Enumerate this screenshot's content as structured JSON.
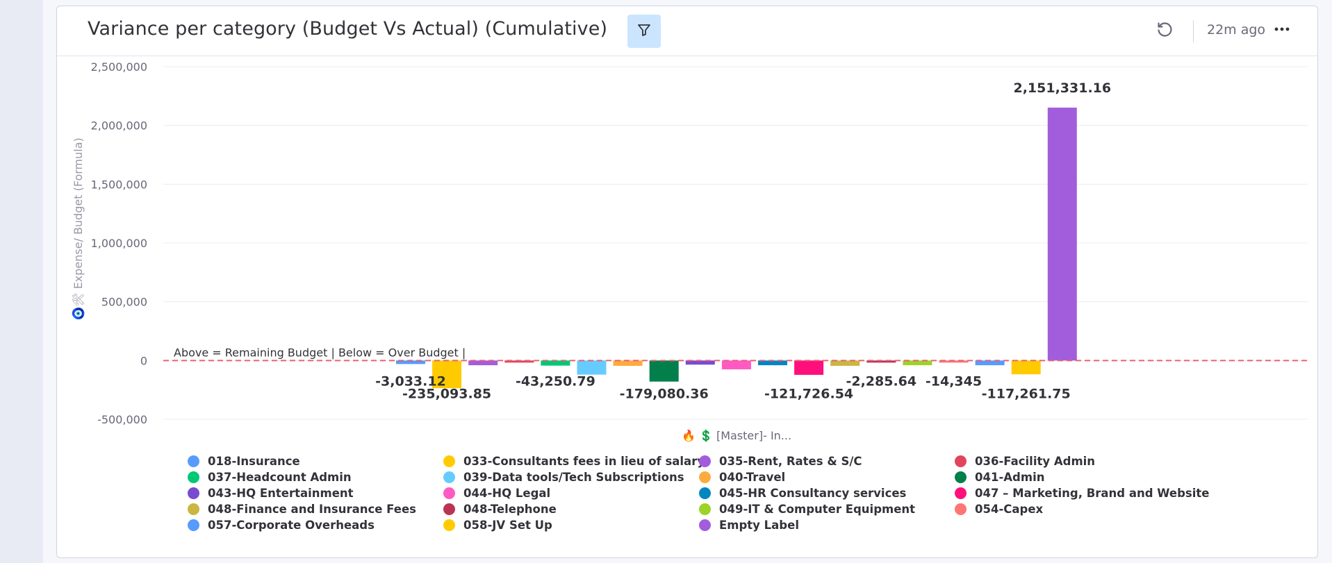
{
  "header": {
    "title": "Variance per category (Budget Vs Actual) (Cumulative)",
    "updated": "22m ago"
  },
  "icons": {
    "filter": "filter-funnel-icon",
    "refresh": "refresh-icon",
    "more": "more-horizontal-icon"
  },
  "chart_data": {
    "type": "bar",
    "title": "Variance per category (Budget Vs Actual) (Cumulative)",
    "ylabel": "🧿🛠 Expense/ Budget (Formula)",
    "xlabel": "🔥 💲 [Master]- In...",
    "ylim": [
      -500000,
      2500000
    ],
    "y_ticks": [
      {
        "value": 2500000,
        "label": "2,500,000"
      },
      {
        "value": 2000000,
        "label": "2,000,000"
      },
      {
        "value": 1500000,
        "label": "1,500,000"
      },
      {
        "value": 1000000,
        "label": "1,000,000"
      },
      {
        "value": 500000,
        "label": "500,000"
      },
      {
        "value": 0,
        "label": "0"
      },
      {
        "value": -500000,
        "label": "-500,000"
      }
    ],
    "grid": true,
    "reference_line": {
      "value": 0,
      "label": "Above = Remaining Budget | Below = Over Budget |",
      "color": "#e8616f"
    },
    "legend_position": "bottom",
    "series": [
      {
        "name": "018-Insurance",
        "color": "#579bfc",
        "value": -30000,
        "label": ""
      },
      {
        "name": "033-Consultants fees in lieu of salary",
        "color": "#ffcb00",
        "value": -235093.85,
        "label": "-235,093.85"
      },
      {
        "name": "035-Rent, Rates & S/C",
        "color": "#a25ddc",
        "value": -40000,
        "label": ""
      },
      {
        "name": "036-Facility Admin",
        "color": "#e2445c",
        "value": -3033.12,
        "label": "-3,033.12"
      },
      {
        "name": "037-Headcount Admin",
        "color": "#00c875",
        "value": -43250.79,
        "label": "-43,250.79"
      },
      {
        "name": "039-Data tools/Tech Subscriptions",
        "color": "#66ccff",
        "value": -120000,
        "label": ""
      },
      {
        "name": "040-Travel",
        "color": "#fdab3d",
        "value": -45000,
        "label": ""
      },
      {
        "name": "041-Admin",
        "color": "#037f4c",
        "value": -179080.36,
        "label": "-179,080.36"
      },
      {
        "name": "043-HQ Entertainment",
        "color": "#784bd1",
        "value": -35000,
        "label": ""
      },
      {
        "name": "044-HQ Legal",
        "color": "#ff5ac4",
        "value": -75000,
        "label": ""
      },
      {
        "name": "045-HR Consultancy services",
        "color": "#0086c0",
        "value": -40000,
        "label": ""
      },
      {
        "name": "047 – Marketing, Brand and Website",
        "color": "#ff0f7b",
        "value": -121726.54,
        "label": "-121,726.54"
      },
      {
        "name": "048-Finance and Insurance Fees",
        "color": "#cab641",
        "value": -45000,
        "label": ""
      },
      {
        "name": "048-Telephone",
        "color": "#bb3354",
        "value": -2285.64,
        "label": "-2,285.64"
      },
      {
        "name": "049-IT & Computer Equipment",
        "color": "#9cd326",
        "value": -40000,
        "label": ""
      },
      {
        "name": "054-Capex",
        "color": "#ff7575",
        "value": -14345,
        "label": "-14,345"
      },
      {
        "name": "057-Corporate Overheads",
        "color": "#579bfc",
        "value": -40000,
        "label": ""
      },
      {
        "name": "058-JV Set Up",
        "color": "#ffcb00",
        "value": -117261.75,
        "label": "-117,261.75"
      },
      {
        "name": "Empty Label",
        "color": "#a25ddc",
        "value": 2151331.16,
        "label": "2,151,331.16"
      }
    ]
  }
}
